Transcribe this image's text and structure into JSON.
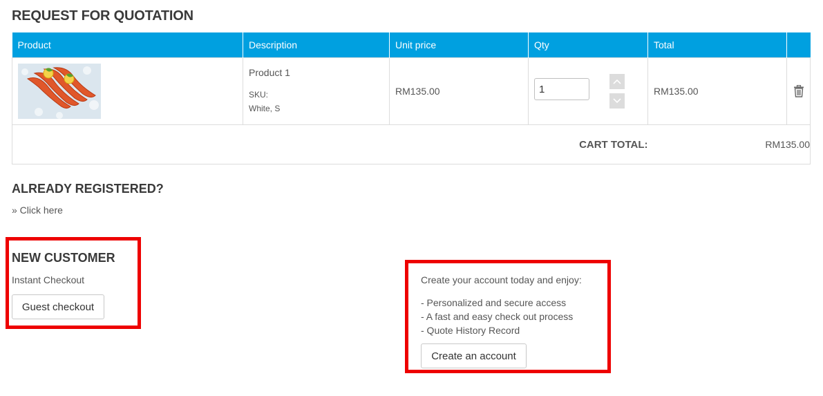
{
  "page": {
    "title": "REQUEST FOR QUOTATION"
  },
  "cart": {
    "columns": [
      "Product",
      "Description",
      "Unit price",
      "Qty",
      "Total",
      ""
    ],
    "items": [
      {
        "image": "shrimp-product-image",
        "name": "Product 1",
        "sku_label": "SKU:",
        "variant": "White, S",
        "unit_price": "RM135.00",
        "qty": "1",
        "total": "RM135.00"
      }
    ],
    "total_label": "CART TOTAL:",
    "total_value": "RM135.00"
  },
  "registered": {
    "heading": "ALREADY REGISTERED?",
    "link": "» Click here"
  },
  "new_customer": {
    "heading": "NEW CUSTOMER",
    "subtext": "Instant Checkout",
    "button": "Guest checkout"
  },
  "create_account": {
    "intro": "Create your account today and enjoy:",
    "benefits": [
      "- Personalized and secure access",
      "- A fast and easy check out process",
      "- Quote History Record"
    ],
    "button": "Create an account"
  },
  "colors": {
    "header_bg": "#00a0e0",
    "highlight": "#ee0000"
  },
  "icons": [
    "trash-icon",
    "chevron-up-icon",
    "chevron-down-icon"
  ]
}
